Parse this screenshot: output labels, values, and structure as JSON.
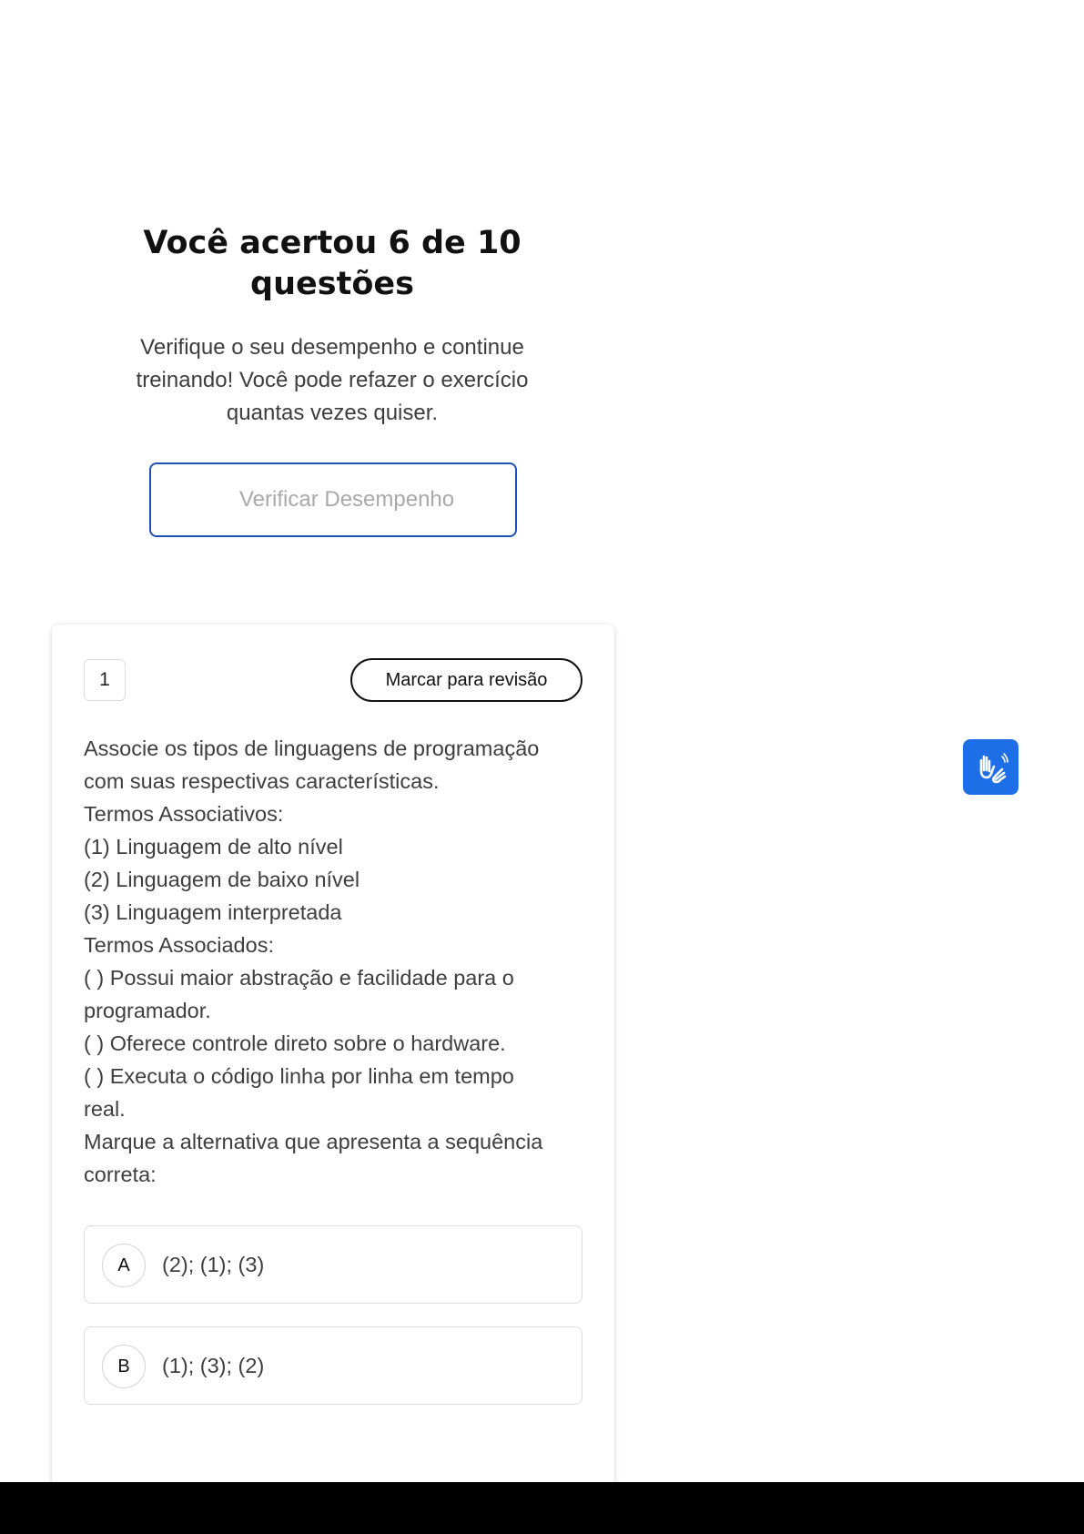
{
  "result": {
    "title": "Você acertou 6 de 10 questões",
    "description": "Verifique o seu desempenho e continue treinando! Você pode refazer o exercício quantas vezes quiser.",
    "button_label": "Verificar Desempenho"
  },
  "question": {
    "number": "1",
    "review_label": "Marcar para revisão",
    "lines": [
      "Associe os tipos de linguagens de programação",
      "com suas respectivas características.",
      "Termos Associativos:",
      "(1) Linguagem de alto nível",
      "(2) Linguagem de baixo nível",
      "(3) Linguagem interpretada",
      "Termos Associados:",
      "( ) Possui maior abstração e facilidade para o",
      "programador.",
      "( ) Oferece controle direto sobre o hardware.",
      "( ) Executa o código linha por linha em tempo",
      "real.",
      "Marque a alternativa que apresenta a sequência",
      "correta:"
    ],
    "options": [
      {
        "letter": "A",
        "text": "(2); (1); (3)"
      },
      {
        "letter": "B",
        "text": "(1); (3); (2)"
      }
    ]
  },
  "accessibility": {
    "icon": "sign-language-hands-icon"
  },
  "colors": {
    "accent_blue": "#1f4fb8",
    "libras_blue": "#1e6ee8"
  }
}
